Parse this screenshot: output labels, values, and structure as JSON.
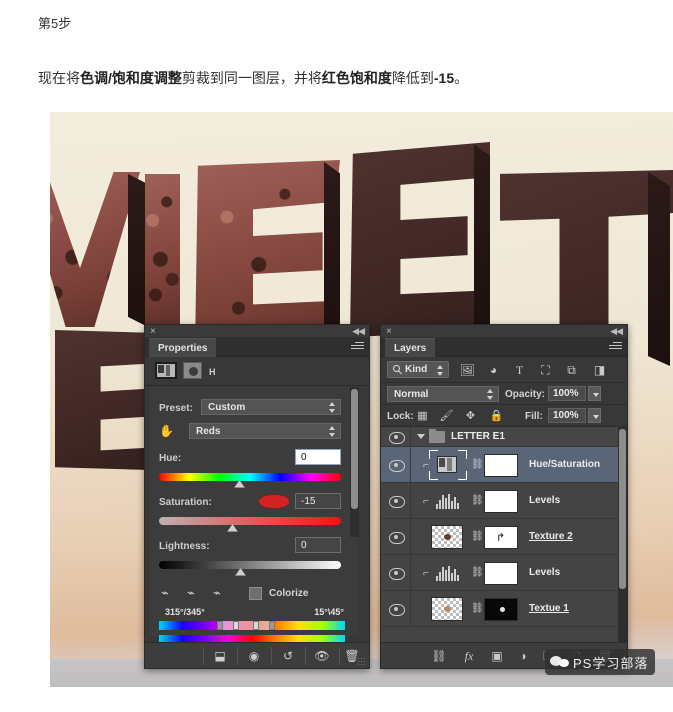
{
  "article": {
    "step_label": "第5步",
    "paragraph_prefix": "现在将",
    "paragraph_bold1": "色调/饱和度调整",
    "paragraph_mid": "剪裁到同一图层，并将",
    "paragraph_bold2": "红色饱和度",
    "paragraph_mid2": "降低到",
    "paragraph_bold3": "-15",
    "paragraph_suffix": "。"
  },
  "canvas": {
    "letters_text": "WEET",
    "background_note": "chocolate-letters-photo"
  },
  "properties_panel": {
    "title": "Properties",
    "close_icon": "×",
    "collapse_icon": "◀◀",
    "menu_icon": "panel-menu-icon",
    "adjustment_badge": "H",
    "preset_label": "Preset:",
    "preset_value": "Custom",
    "channel_value": "Reds",
    "hue_label": "Hue:",
    "hue_value": "0",
    "saturation_label": "Saturation:",
    "saturation_value": "-15",
    "lightness_label": "Lightness:",
    "lightness_value": "0",
    "colorize_label": "Colorize",
    "range_left": "315°/345°",
    "range_right": "15°\\45°",
    "footer_icons": [
      "clip-to-layer-icon",
      "view-previous-state-icon",
      "reset-icon",
      "toggle-visibility-icon",
      "delete-icon"
    ]
  },
  "layers_panel": {
    "title": "Layers",
    "close_icon": "×",
    "collapse_icon": "◀◀",
    "menu_icon": "panel-menu-icon",
    "filter_kind": "Kind",
    "filter_icons": [
      "pixel-filter-icon",
      "adjustment-filter-icon",
      "type-filter-icon",
      "shape-filter-icon",
      "smart-object-filter-icon",
      "toggle-filter-icon"
    ],
    "blend_mode": "Normal",
    "opacity_label": "Opacity:",
    "opacity_value": "100%",
    "lock_label": "Lock:",
    "lock_icons": [
      "lock-transparent-pixels-icon",
      "lock-image-pixels-icon",
      "lock-position-icon",
      "lock-all-icon"
    ],
    "fill_label": "Fill:",
    "fill_value": "100%",
    "rows": [
      {
        "type": "group",
        "name": "LETTER E1",
        "visible": true,
        "selected": false
      },
      {
        "type": "adjustment",
        "name": "Hue/Saturation",
        "visible": true,
        "selected": true,
        "clipped": true,
        "mask": "white"
      },
      {
        "type": "levels",
        "name": "Levels",
        "visible": true,
        "selected": false,
        "clipped": true,
        "mask": "white"
      },
      {
        "type": "pixel",
        "name": "Texture 2",
        "visible": true,
        "selected": false,
        "clipped": false,
        "mask": "white-arrow"
      },
      {
        "type": "levels",
        "name": "Levels",
        "visible": true,
        "selected": false,
        "clipped": true,
        "mask": "white"
      },
      {
        "type": "pixel",
        "name": "Textue 1",
        "visible": true,
        "selected": false,
        "clipped": false,
        "mask": "black"
      }
    ],
    "footer_icons": [
      "link-layers-icon",
      "layer-style-fx-icon",
      "add-layer-mask-icon",
      "new-adjustment-layer-icon",
      "new-group-icon",
      "new-layer-icon",
      "delete-layer-icon"
    ]
  },
  "watermark": {
    "text": "PS学习部落",
    "logo_icon": "wechat-logo-icon"
  },
  "colors": {
    "panel_bg": "#383838",
    "panel_list_bg": "#444444",
    "selected_row": "#5a6578",
    "accent_red": "#d42222"
  }
}
